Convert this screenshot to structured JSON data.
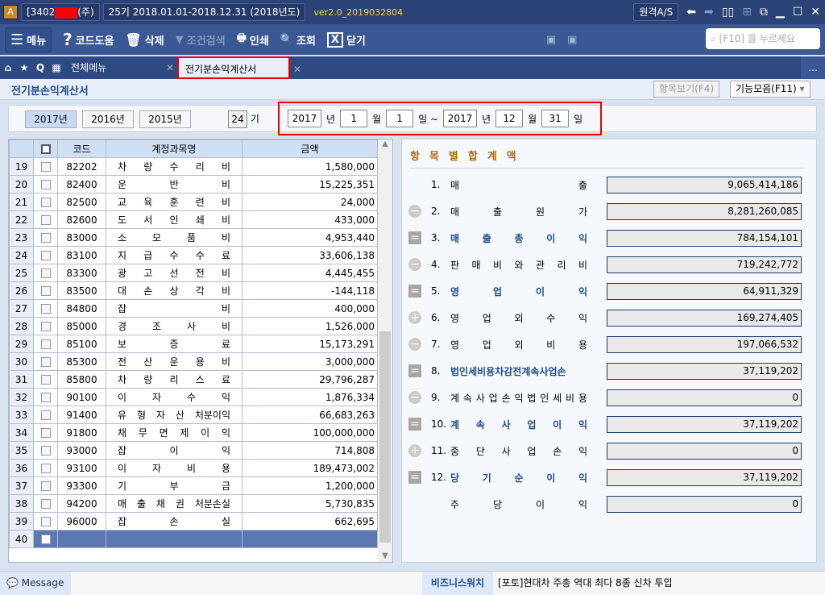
{
  "titlebar": {
    "company": "[3402",
    "company_suffix": "(주)",
    "period": "25기  2018.01.01-2018.12.31",
    "year_label": "(2018년도)",
    "version": "ver2.0_2019032804",
    "remote_as": "원격A/S"
  },
  "toolbar": {
    "menu": "메뉴",
    "code_help": "코드도움",
    "delete": "삭제",
    "filter": "조건검색",
    "print": "인쇄",
    "search": "조회",
    "close": "닫기",
    "search_placeholder": "[F10] 을 누르세요"
  },
  "tabs": [
    {
      "label": "전체메뉴"
    },
    {
      "label": "전기분손익계산서"
    }
  ],
  "page": {
    "title": "전기분손익계산서",
    "item_view": "항목보기(F4)",
    "functions": "기능모음(F11)"
  },
  "filter": {
    "years": [
      "2017년",
      "2016년",
      "2015년"
    ],
    "period_no": "24",
    "period_unit": "기",
    "from_year": "2017",
    "from_month": "1",
    "from_day": "1",
    "to_year": "2017",
    "to_month": "12",
    "to_day": "31",
    "year_unit": "년",
    "month_unit": "월",
    "day_unit": "일",
    "tilde": "일 ~"
  },
  "grid": {
    "headers": [
      "코드",
      "계정과목명",
      "금액"
    ],
    "rows": [
      {
        "no": "19",
        "code": "82202",
        "name": "차 량 수 리 비",
        "amount": "1,580,000"
      },
      {
        "no": "20",
        "code": "82400",
        "name": "운 반 비",
        "amount": "15,225,351"
      },
      {
        "no": "21",
        "code": "82500",
        "name": "교 육 훈 련 비",
        "amount": "24,000"
      },
      {
        "no": "22",
        "code": "82600",
        "name": "도 서 인 쇄 비",
        "amount": "433,000"
      },
      {
        "no": "23",
        "code": "83000",
        "name": "소 모 품 비",
        "amount": "4,953,440"
      },
      {
        "no": "24",
        "code": "83100",
        "name": "지 급 수 수 료",
        "amount": "33,606,138"
      },
      {
        "no": "25",
        "code": "83300",
        "name": "광 고 선 전 비",
        "amount": "4,445,455"
      },
      {
        "no": "26",
        "code": "83500",
        "name": "대 손 상 각 비",
        "amount": "-144,118"
      },
      {
        "no": "27",
        "code": "84800",
        "name": "잡 비",
        "amount": "400,000"
      },
      {
        "no": "28",
        "code": "85000",
        "name": "경 조 사 비",
        "amount": "1,526,000"
      },
      {
        "no": "29",
        "code": "85100",
        "name": "보 증 료",
        "amount": "15,173,291"
      },
      {
        "no": "30",
        "code": "85300",
        "name": "전 산 운 용 비",
        "amount": "3,000,000"
      },
      {
        "no": "31",
        "code": "85800",
        "name": "차 량 리 스 료",
        "amount": "29,796,287"
      },
      {
        "no": "32",
        "code": "90100",
        "name": "이 자 수 익",
        "amount": "1,876,334"
      },
      {
        "no": "33",
        "code": "91400",
        "name": "유 형 자 산 처분이익",
        "amount": "66,683,263"
      },
      {
        "no": "34",
        "code": "91800",
        "name": "채 무 면 제 이 익",
        "amount": "100,000,000"
      },
      {
        "no": "35",
        "code": "93000",
        "name": "잡 이 익",
        "amount": "714,808"
      },
      {
        "no": "36",
        "code": "93100",
        "name": "이 자 비 용",
        "amount": "189,473,002"
      },
      {
        "no": "37",
        "code": "93300",
        "name": "기 부 금",
        "amount": "1,200,000"
      },
      {
        "no": "38",
        "code": "94200",
        "name": "매 출 채 권 처분손실",
        "amount": "5,730,835"
      },
      {
        "no": "39",
        "code": "96000",
        "name": "잡 손 실",
        "amount": "662,695"
      },
      {
        "no": "40",
        "code": "",
        "name": "",
        "amount": ""
      }
    ]
  },
  "summary": {
    "title": "항목별합계액",
    "items": [
      {
        "num": "1.",
        "label": "매 출",
        "value": "9,065,414,186",
        "icon": "none",
        "bold": false
      },
      {
        "num": "2.",
        "label": "매 출 원 가",
        "value": "8,281,260,085",
        "icon": "minus",
        "bold": false
      },
      {
        "num": "3.",
        "label": "매 출 총 이 익",
        "value": "784,154,101",
        "icon": "eq",
        "bold": true
      },
      {
        "num": "4.",
        "label": "판 매 비 와 관 리 비",
        "value": "719,242,772",
        "icon": "minus",
        "bold": false
      },
      {
        "num": "5.",
        "label": "영 업 이 익",
        "value": "64,911,329",
        "icon": "eq",
        "bold": true
      },
      {
        "num": "6.",
        "label": "영 업 외 수 익",
        "value": "169,274,405",
        "icon": "plus",
        "bold": false
      },
      {
        "num": "7.",
        "label": "영 업 외 비 용",
        "value": "197,066,532",
        "icon": "minus",
        "bold": false
      },
      {
        "num": "8.",
        "label": "법인세비용차감전계속사업손",
        "value": "37,119,202",
        "icon": "eq",
        "bold": true
      },
      {
        "num": "9.",
        "label": "계 속 사 업 손 익 법 인 세 비 용",
        "value": "0",
        "icon": "minus",
        "bold": false
      },
      {
        "num": "10.",
        "label": "계 속 사 업 이 익",
        "value": "37,119,202",
        "icon": "eq",
        "bold": true
      },
      {
        "num": "11.",
        "label": "중 단 사 업 손 익",
        "value": "0",
        "icon": "plus",
        "bold": false
      },
      {
        "num": "12.",
        "label": "당 기 순 이 익",
        "value": "37,119,202",
        "icon": "eq",
        "bold": true
      },
      {
        "num": "",
        "label": "주 당 이 익",
        "value": "0",
        "icon": "none",
        "bold": false
      }
    ]
  },
  "status": {
    "message": "Message",
    "business_watch": "비즈니스워치",
    "news": "[포토]현대차 주총 역대 최다 8종 신차 투입"
  }
}
